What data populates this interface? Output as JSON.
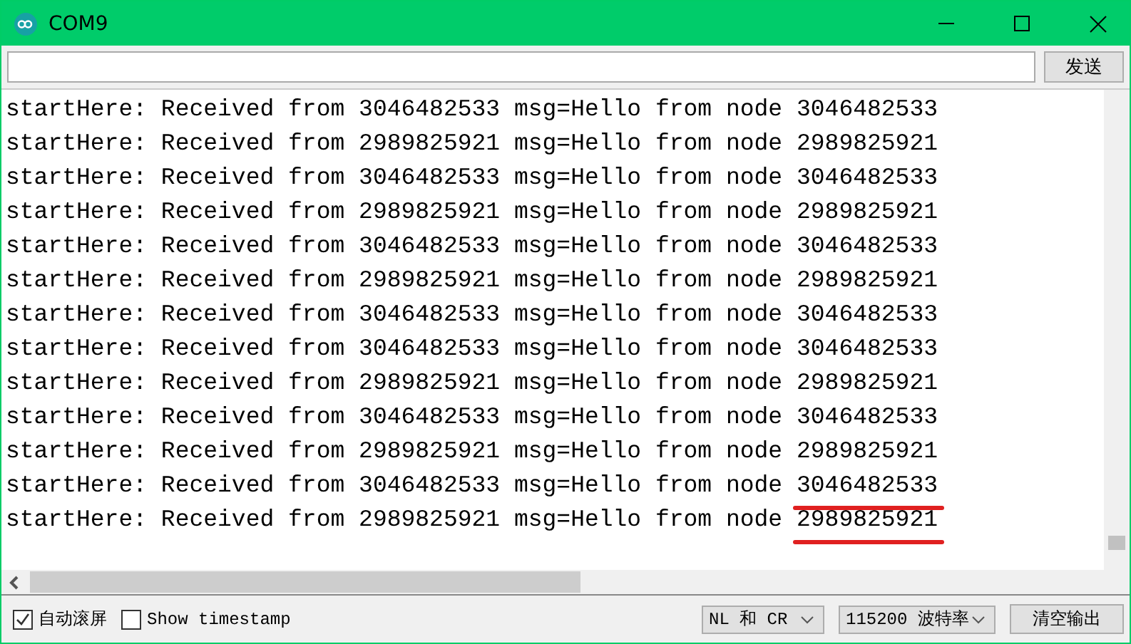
{
  "window": {
    "title": "COM9"
  },
  "send": {
    "button": "发送"
  },
  "output": [
    {
      "text": "startHere: Received from 3046482533 msg=Hello from node",
      "node": "3046482533",
      "underlined": false
    },
    {
      "text": "startHere: Received from 2989825921 msg=Hello from node",
      "node": "2989825921",
      "underlined": false
    },
    {
      "text": "startHere: Received from 3046482533 msg=Hello from node",
      "node": "3046482533",
      "underlined": false
    },
    {
      "text": "startHere: Received from 2989825921 msg=Hello from node",
      "node": "2989825921",
      "underlined": false
    },
    {
      "text": "startHere: Received from 3046482533 msg=Hello from node",
      "node": "3046482533",
      "underlined": false
    },
    {
      "text": "startHere: Received from 2989825921 msg=Hello from node",
      "node": "2989825921",
      "underlined": false
    },
    {
      "text": "startHere: Received from 3046482533 msg=Hello from node",
      "node": "3046482533",
      "underlined": false
    },
    {
      "text": "startHere: Received from 3046482533 msg=Hello from node",
      "node": "3046482533",
      "underlined": false
    },
    {
      "text": "startHere: Received from 2989825921 msg=Hello from node",
      "node": "2989825921",
      "underlined": false
    },
    {
      "text": "startHere: Received from 3046482533 msg=Hello from node",
      "node": "3046482533",
      "underlined": false
    },
    {
      "text": "startHere: Received from 2989825921 msg=Hello from node",
      "node": "2989825921",
      "underlined": false
    },
    {
      "text": "startHere: Received from 3046482533 msg=Hello from node",
      "node": "3046482533",
      "underlined": true
    },
    {
      "text": "startHere: Received from 2989825921 msg=Hello from node",
      "node": "2989825921",
      "underlined": true
    }
  ],
  "footer": {
    "autoscroll": {
      "label": "自动滚屏",
      "checked": true
    },
    "timestamp": {
      "label": "Show timestamp",
      "checked": false
    },
    "line_ending": "NL 和 CR",
    "baud": "115200 波特率",
    "clear": "清空输出"
  }
}
